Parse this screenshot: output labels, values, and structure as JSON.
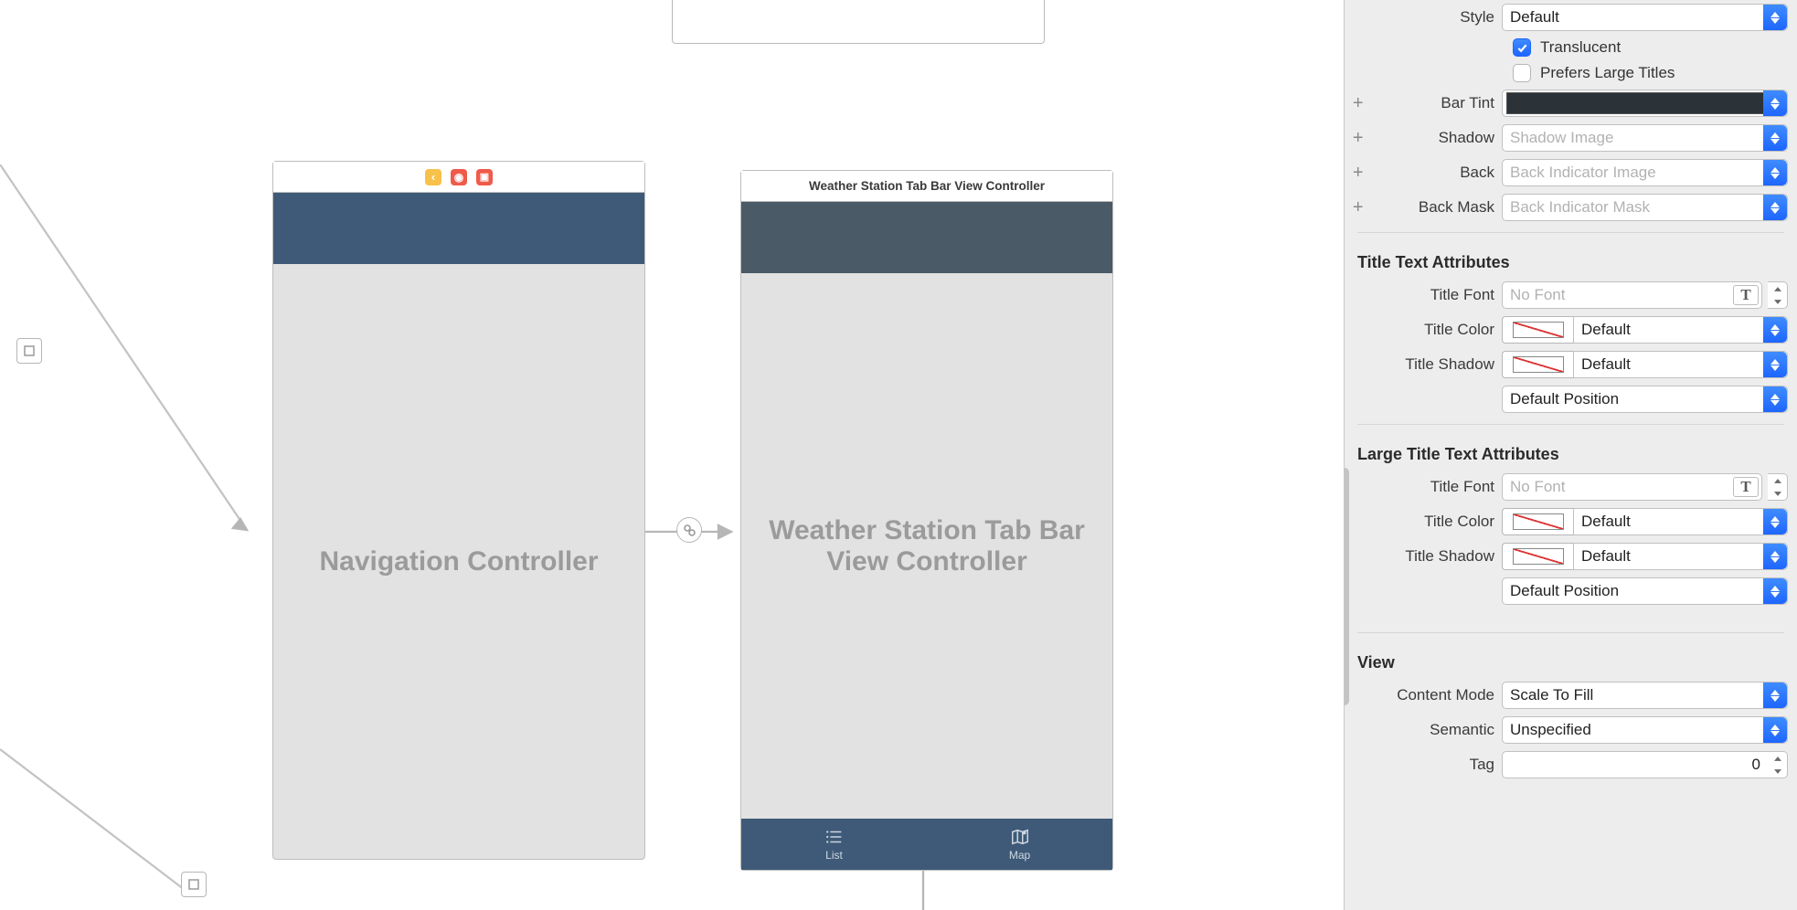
{
  "canvas": {
    "scene1": {
      "title": "Navigation Controller"
    },
    "scene2": {
      "header": "Weather Station Tab Bar View Controller",
      "title": "Weather Station Tab Bar View Controller",
      "tabs": [
        {
          "label": "List"
        },
        {
          "label": "Map"
        }
      ]
    }
  },
  "inspector": {
    "navbar": {
      "style_label": "Style",
      "style_value": "Default",
      "translucent_label": "Translucent",
      "translucent_checked": true,
      "prefers_large_titles_label": "Prefers Large Titles",
      "prefers_large_titles_checked": false,
      "bar_tint_label": "Bar Tint",
      "bar_tint_color": "#2b3238",
      "shadow_label": "Shadow",
      "shadow_placeholder": "Shadow Image",
      "back_label": "Back",
      "back_placeholder": "Back Indicator Image",
      "back_mask_label": "Back Mask",
      "back_mask_placeholder": "Back Indicator Mask"
    },
    "title_attrs": {
      "section": "Title Text Attributes",
      "font_label": "Title Font",
      "font_placeholder": "No Font",
      "color_label": "Title Color",
      "color_value": "Default",
      "shadow_label": "Title Shadow",
      "shadow_value": "Default",
      "position_value": "Default Position"
    },
    "large_title_attrs": {
      "section": "Large Title Text Attributes",
      "font_label": "Title Font",
      "font_placeholder": "No Font",
      "color_label": "Title Color",
      "color_value": "Default",
      "shadow_label": "Title Shadow",
      "shadow_value": "Default",
      "position_value": "Default Position"
    },
    "view": {
      "section": "View",
      "content_mode_label": "Content Mode",
      "content_mode_value": "Scale To Fill",
      "semantic_label": "Semantic",
      "semantic_value": "Unspecified",
      "tag_label": "Tag",
      "tag_value": "0"
    }
  }
}
